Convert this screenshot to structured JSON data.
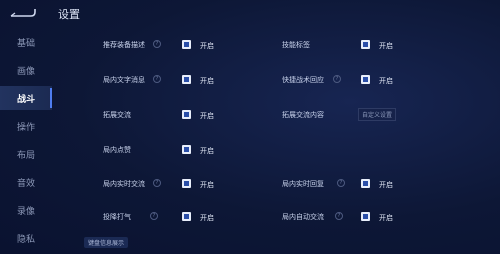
{
  "header": {
    "title": "设置",
    "back_icon": "back-arrow-icon"
  },
  "sidebar": {
    "items": [
      {
        "label": "基础",
        "active": false
      },
      {
        "label": "画像",
        "active": false
      },
      {
        "label": "战斗",
        "active": true
      },
      {
        "label": "操作",
        "active": false
      },
      {
        "label": "布局",
        "active": false
      },
      {
        "label": "音效",
        "active": false
      },
      {
        "label": "录像",
        "active": false
      },
      {
        "label": "隐私",
        "active": false
      }
    ]
  },
  "settings": [
    {
      "label": "推荐装备描述",
      "option": "开启",
      "checked": true
    },
    {
      "label": "技能标签",
      "option": "开启",
      "checked": true
    },
    {
      "label": "局内文字消息",
      "option": "开启",
      "checked": true
    },
    {
      "label": "快捷战术回应",
      "option": "开启",
      "checked": true
    },
    {
      "label": "拓展交流",
      "option": "开启",
      "checked": true
    },
    {
      "label": "拓展交流内容",
      "button": "自定义设置"
    },
    {
      "label": "局内点赞",
      "option": "开启",
      "checked": true
    },
    {
      "label": "局内实时交流",
      "option": "开启",
      "checked": true
    },
    {
      "label": "局内实时回复",
      "option": "开启",
      "checked": true
    },
    {
      "label": "投降打气",
      "option": "开启",
      "checked": true
    },
    {
      "label": "局内自动交流",
      "option": "开启",
      "checked": true
    }
  ],
  "bottom": {
    "label": "键盘信息展示"
  },
  "colors": {
    "accent": "#4f7df0",
    "background": "#0c1531",
    "checkbox": "#e8eefb"
  }
}
